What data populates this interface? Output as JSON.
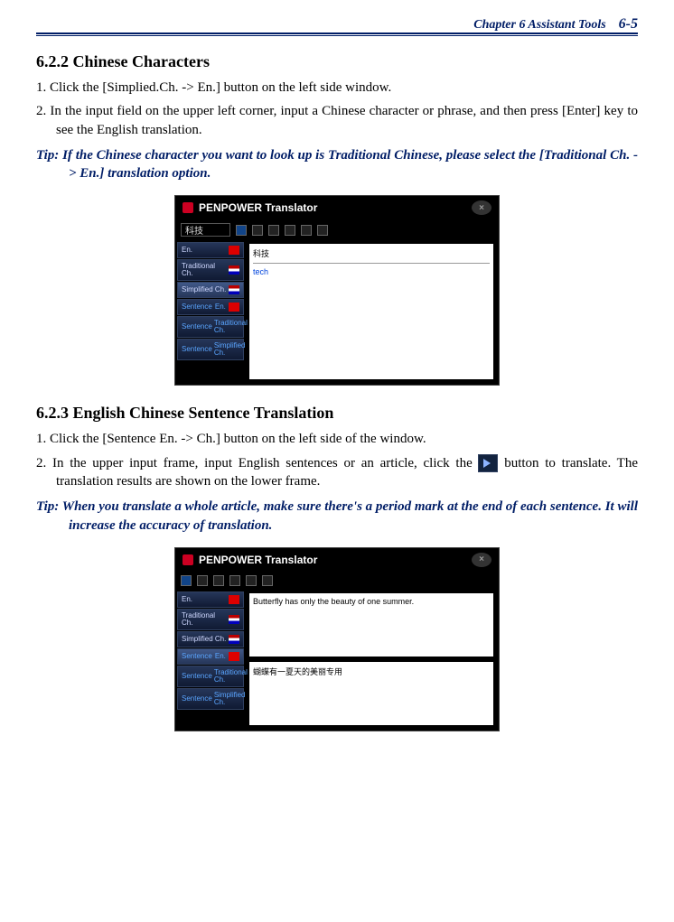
{
  "header": {
    "chapter_label": "Chapter 6 Assistant Tools",
    "page_number": "6-5"
  },
  "section_622": {
    "heading": "6.2.2 Chinese Characters",
    "step1": "1. Click the [Simplied.Ch. -> En.] button on the left side window.",
    "step2": "2. In the input field on the upper left corner, input a Chinese character or phrase, and then press [Enter] key to see the English translation.",
    "tip": "Tip: If the Chinese character you want to look up is Traditional Chinese, please select the [Traditional Ch. -> En.] translation option."
  },
  "figure1": {
    "app_title": "PENPOWER Translator",
    "search_value": "科技",
    "tabs": {
      "en": "En.",
      "trad": "Traditional Ch.",
      "simp": "Simplified Ch.",
      "sentence_en": "En.",
      "sentence_trad": "Traditional Ch.",
      "sentence_simp": "Simplified Ch.",
      "sentence_label": "Sentence"
    },
    "panel_upper": "科技",
    "panel_translation": "tech"
  },
  "section_623": {
    "heading": "6.2.3 English Chinese Sentence Translation",
    "step1": "1. Click the [Sentence En. -> Ch.] button on the left side of the window.",
    "step2_a": "2. In the upper input frame, input English sentences or an article, click the ",
    "step2_b": " button to translate. The translation results are shown on the lower frame.",
    "tip": "Tip: When you translate a whole article, make sure there's a period mark at the end of each sentence. It will increase the accuracy of translation."
  },
  "figure2": {
    "app_title": "PENPOWER Translator",
    "upper_text": "Butterfly has only the beauty of one summer.",
    "lower_text": "蝴蝶有一夏天的美丽专用"
  }
}
